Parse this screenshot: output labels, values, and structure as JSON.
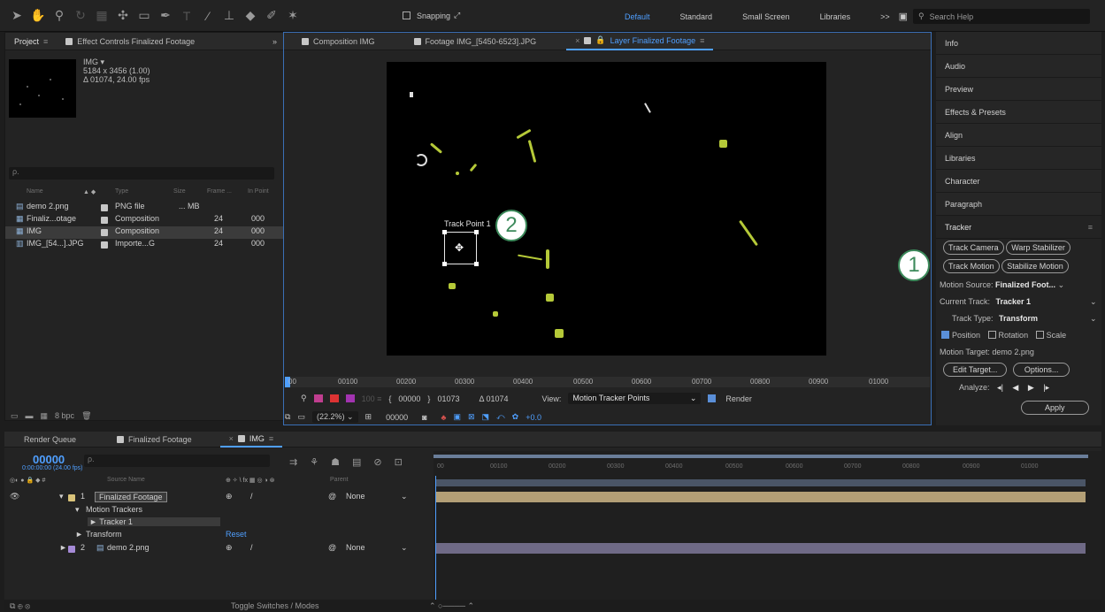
{
  "toolbar": {
    "snapping_label": "Snapping",
    "workspaces": [
      "Default",
      "Standard",
      "Small Screen",
      "Libraries"
    ],
    "more": ">>",
    "search_placeholder": "Search Help"
  },
  "project_panel": {
    "tabs": [
      "Project",
      "Effect Controls Finalized Footage"
    ],
    "item_name": "IMG ▾",
    "item_dims": "5184 x 3456 (1.00)",
    "item_dur": "Δ 01074, 24.00 fps",
    "search_icon": "ρ.",
    "columns": [
      "Name",
      "Type",
      "Size",
      "Frame ...",
      "In Point"
    ],
    "rows": [
      {
        "name": "demo 2.png",
        "type": "PNG file",
        "size": "... MB",
        "frame": "",
        "in": ""
      },
      {
        "name": "Finaliz...otage",
        "type": "Composition",
        "size": "",
        "frame": "24",
        "in": "000"
      },
      {
        "name": "IMG",
        "type": "Composition",
        "size": "",
        "frame": "24",
        "in": "000"
      },
      {
        "name": "IMG_[54...].JPG",
        "type": "Importe...G",
        "size": "",
        "frame": "24",
        "in": "000"
      }
    ],
    "footer_bpc": "8 bpc"
  },
  "viewer": {
    "tabs": [
      "Composition IMG",
      "Footage IMG_[5450-6523].JPG",
      "Layer Finalized Footage"
    ],
    "track_point_label": "Track Point 1",
    "ruler_ticks": [
      "00",
      "00100",
      "00200",
      "00300",
      "00400",
      "00500",
      "00600",
      "00700",
      "00800",
      "00900",
      "01000"
    ],
    "in_time": "00000",
    "out_time": "01073",
    "duration": "Δ 01074",
    "view_label": "View:",
    "view_value": "Motion Tracker Points",
    "render_label": "Render",
    "zoom": "(22.2%)",
    "current_time": "00000",
    "exposure": "+0.0"
  },
  "annotations": {
    "badge_1": "1",
    "badge_2": "2"
  },
  "right_panel": {
    "items": [
      "Info",
      "Audio",
      "Preview",
      "Effects & Presets",
      "Align",
      "Libraries",
      "Character",
      "Paragraph"
    ],
    "tracker_title": "Tracker",
    "buttons": {
      "track_camera": "Track Camera",
      "warp_stabilizer": "Warp Stabilizer",
      "track_motion": "Track Motion",
      "stabilize_motion": "Stabilize Motion",
      "edit_target": "Edit Target...",
      "options": "Options...",
      "apply": "Apply"
    },
    "motion_source_label": "Motion Source:",
    "motion_source_value": "Finalized Foot...",
    "current_track_label": "Current Track:",
    "current_track_value": "Tracker 1",
    "track_type_label": "Track Type:",
    "track_type_value": "Transform",
    "chk_position": "Position",
    "chk_rotation": "Rotation",
    "chk_scale": "Scale",
    "motion_target": "Motion Target: demo 2.png",
    "analyze_label": "Analyze:"
  },
  "timeline": {
    "tabs": [
      "Render Queue",
      "Finalized Footage",
      "IMG"
    ],
    "timecode": "00000",
    "timecode_sub": "0:00:00:00 (24.00 fps)",
    "col_source": "Source Name",
    "col_parent": "Parent",
    "layers": {
      "l1_num": "1",
      "l1_name": "Finalized Footage",
      "l1_parent": "None",
      "motion_trackers": "Motion Trackers",
      "tracker1": "Tracker 1",
      "transform": "Transform",
      "reset": "Reset",
      "l2_num": "2",
      "l2_name": "demo 2.png",
      "l2_parent": "None"
    },
    "ruler_ticks": [
      "00",
      "00100",
      "00200",
      "00300",
      "00400",
      "00500",
      "00600",
      "00700",
      "00800",
      "00900",
      "01000"
    ],
    "footer": "Toggle Switches / Modes"
  }
}
